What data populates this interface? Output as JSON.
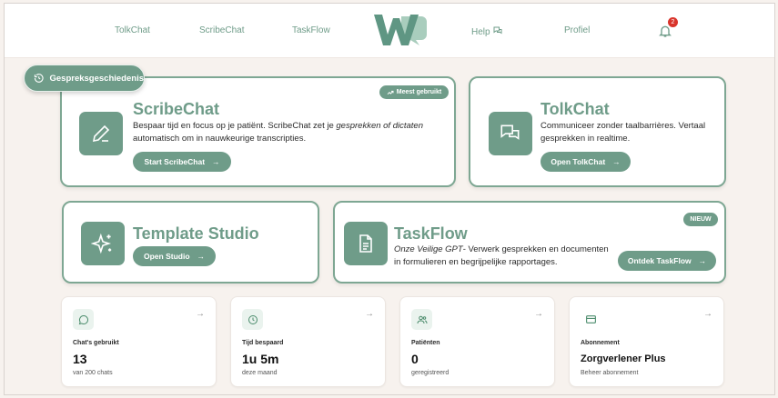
{
  "nav": {
    "tolkchat": "TolkChat",
    "scribechat": "ScribeChat",
    "taskflow": "TaskFlow",
    "help": "Help",
    "profiel": "Profiel",
    "notification_count": "2"
  },
  "history_button": "Gespreksgeschiedenis",
  "scribe": {
    "badge": "Meest gebruikt",
    "title": "ScribeChat",
    "desc_1": "Bespaar tijd en focus op je patiënt. ScribeChat zet je ",
    "desc_em": "gesprekken of dictaten",
    "desc_2": " automatisch om in nauwkeurige transcripties.",
    "button": "Start ScribeChat"
  },
  "tolk": {
    "title": "TolkChat",
    "desc": "Communiceer zonder taalbarrières. Vertaal gesprekken in realtime.",
    "button": "Open TolkChat"
  },
  "template": {
    "title": "Template Studio",
    "button": "Open Studio"
  },
  "taskflow": {
    "badge": "NIEUW",
    "title": "TaskFlow",
    "desc_em": "Onze Veilige GPT",
    "desc_rest": "- Verwerk gesprekken en documenten in formulieren en begrijpelijke rapportages.",
    "button": "Ontdek TaskFlow"
  },
  "stats": [
    {
      "label": "Chat's gebruikt",
      "value": "13",
      "sub": "van 200 chats",
      "icon": "chat-bubble-icon"
    },
    {
      "label": "Tijd bespaard",
      "value": "1u 5m",
      "sub": "deze maand",
      "icon": "clock-icon"
    },
    {
      "label": "Patiënten",
      "value": "0",
      "sub": "geregistreerd",
      "icon": "users-icon"
    },
    {
      "label": "Abonnement",
      "value": "Zorgverlener Plus",
      "sub": "Beheer abonnement",
      "icon": "credit-card-icon"
    }
  ],
  "colors": {
    "accent": "#6f9c89",
    "background": "#f7f2ee",
    "notification": "#d9342b"
  }
}
